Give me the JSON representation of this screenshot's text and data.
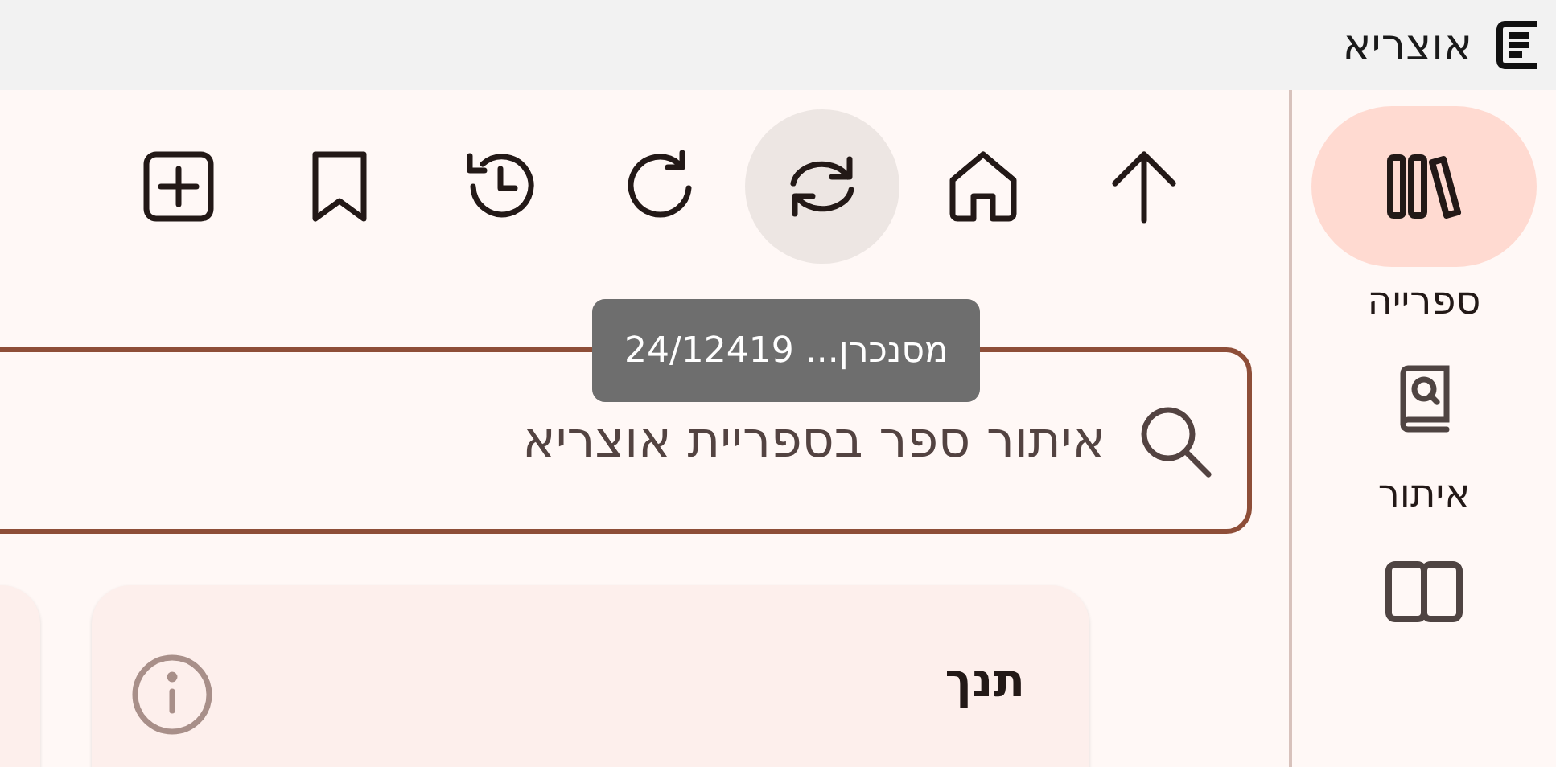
{
  "window": {
    "title": "אוצריא"
  },
  "nav_rail": {
    "items": [
      {
        "kind": "library",
        "label": "ספרייה",
        "selected": true
      },
      {
        "kind": "find",
        "label": "איתור",
        "selected": false
      },
      {
        "kind": "book",
        "selected": false
      }
    ]
  },
  "toolbar": {
    "buttons": [
      {
        "kind": "up",
        "hovered": false
      },
      {
        "kind": "home",
        "hovered": false
      },
      {
        "kind": "sync",
        "hovered": true
      },
      {
        "kind": "refresh",
        "hovered": false
      },
      {
        "kind": "history",
        "hovered": false
      },
      {
        "kind": "bookmark",
        "hovered": false
      },
      {
        "kind": "add",
        "hovered": false
      }
    ]
  },
  "tooltip": {
    "text": "מסנכרן... 24/12419"
  },
  "search": {
    "placeholder": "איתור ספר בספריית אוצריא"
  },
  "cards": [
    {
      "kind": "full",
      "title": "תנך"
    },
    {
      "kind": "edge"
    }
  ]
}
